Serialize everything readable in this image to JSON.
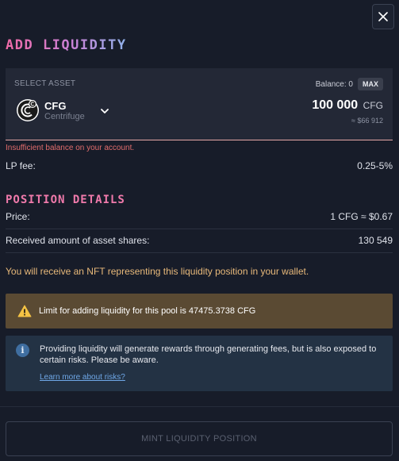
{
  "title": "ADD LIQUIDITY",
  "asset_selector": {
    "label": "SELECT ASSET",
    "symbol": "CFG",
    "name": "Centrifuge",
    "balance_label": "Balance: 0",
    "max_label": "MAX",
    "amount": "100 000",
    "amount_unit": "CFG",
    "usd_value": "≈ $66 912"
  },
  "error_message": "Insufficient balance on your account.",
  "lp_fee": {
    "label": "LP fee:",
    "value": "0.25-5%"
  },
  "position_details": {
    "title": "POSITION DETAILS",
    "price": {
      "label": "Price:",
      "value": "1 CFG ≈ $0.67"
    },
    "shares": {
      "label": "Received amount of asset shares:",
      "value": "130 549"
    }
  },
  "nft_note": "You will receive an NFT representing this liquidity position in your wallet.",
  "warning": {
    "text": "Limit for adding liquidity for this pool is 47475.3738 CFG"
  },
  "info": {
    "text": "Providing liquidity will generate rewards through generating fees, but is also exposed to certain risks. Please be aware.",
    "link": "Learn more about risks?"
  },
  "mint_button": "MINT LIQUIDITY POSITION",
  "icons": {
    "close": "close-icon",
    "coin": "centrifuge-logo-icon",
    "chevron": "chevron-down-icon",
    "warning": "warning-icon",
    "info": "info-icon"
  },
  "colors": {
    "background": "#171c29",
    "accent_pink": "#f06aa7",
    "error": "#e06c6c",
    "warning_bg": "#5a4a33",
    "info_bg": "#233244",
    "link": "#6fa8e8"
  }
}
